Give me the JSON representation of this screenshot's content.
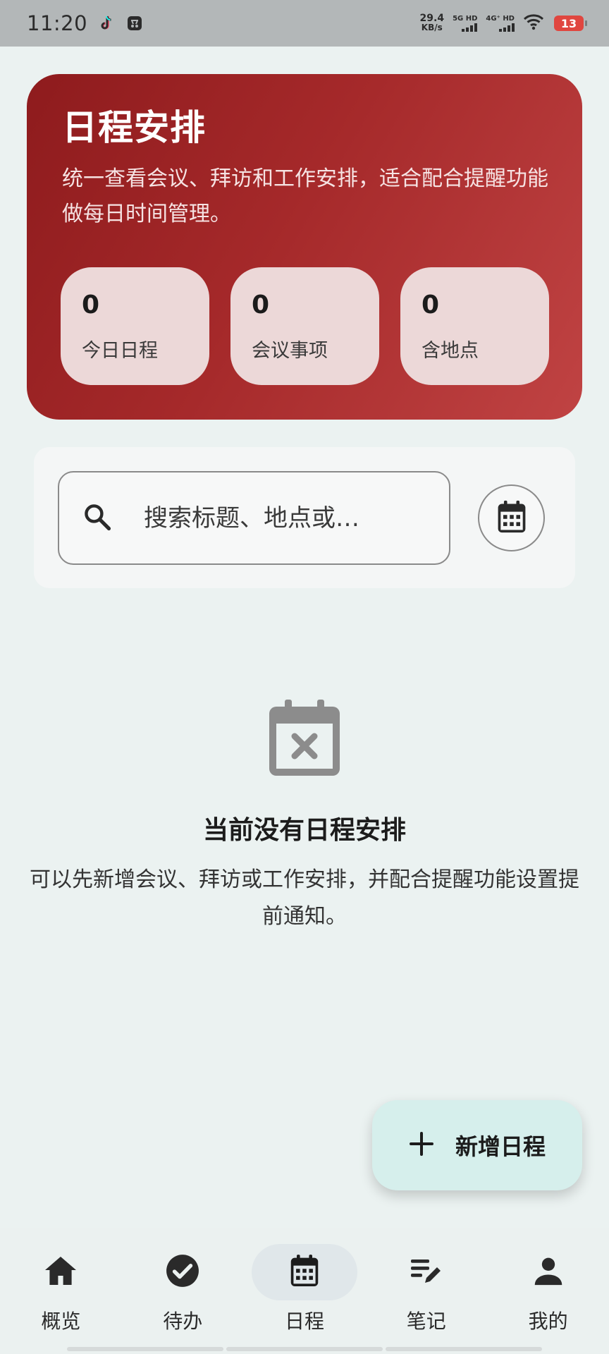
{
  "status_bar": {
    "time": "11:20",
    "net_speed_value": "29.4",
    "net_speed_unit": "KB/s",
    "signal1_label": "5G HD",
    "signal2_label": "4G⁺ HD",
    "battery": "13"
  },
  "hero": {
    "title": "日程安排",
    "description": "统一查看会议、拜访和工作安排，适合配合提醒功能做每日时间管理。",
    "stats": [
      {
        "value": "0",
        "label": "今日日程"
      },
      {
        "value": "0",
        "label": "会议事项"
      },
      {
        "value": "0",
        "label": "含地点"
      }
    ]
  },
  "search": {
    "placeholder": "搜索标题、地点或…"
  },
  "empty_state": {
    "title": "当前没有日程安排",
    "description": "可以先新增会议、拜访或工作安排，并配合提醒功能设置提前通知。"
  },
  "fab": {
    "label": "新增日程"
  },
  "bottom_nav": {
    "items": [
      {
        "label": "概览",
        "icon": "home-icon"
      },
      {
        "label": "待办",
        "icon": "check-circle-icon"
      },
      {
        "label": "日程",
        "icon": "calendar-icon",
        "active": true
      },
      {
        "label": "笔记",
        "icon": "notes-edit-icon"
      },
      {
        "label": "我的",
        "icon": "person-icon"
      }
    ]
  },
  "colors": {
    "hero_gradient_start": "#8e1b1d",
    "hero_gradient_end": "#c04343",
    "stat_card_bg": "#ecd8d8",
    "fab_bg": "#d6efec",
    "page_bg": "#ebf2f1"
  }
}
